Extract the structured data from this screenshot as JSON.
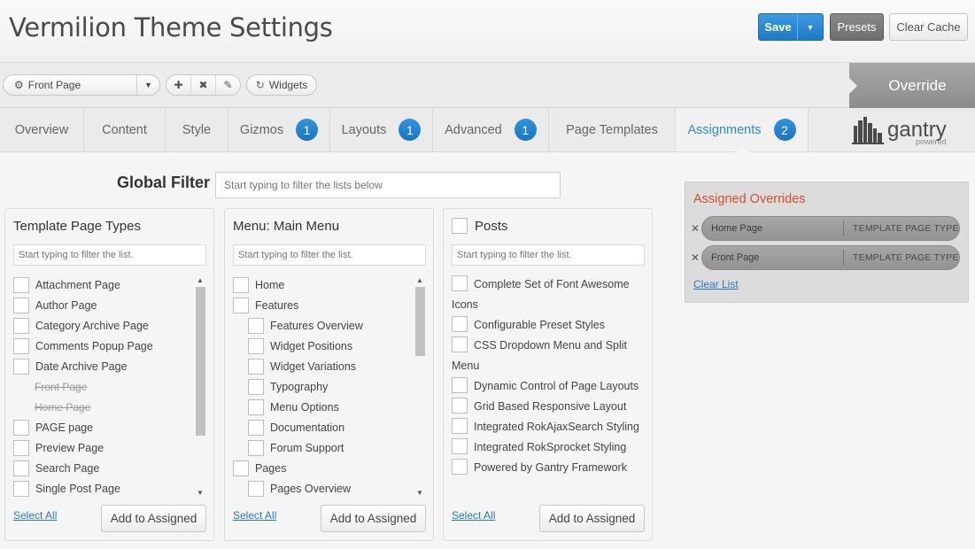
{
  "header": {
    "title": "Vermilion Theme Settings",
    "save_label": "Save",
    "presets_label": "Presets",
    "clear_cache_label": "Clear Cache"
  },
  "toolbar": {
    "page_selected": "Front Page",
    "widgets_label": "Widgets",
    "override_label": "Override"
  },
  "tabs": [
    {
      "label": "Overview",
      "badge": ""
    },
    {
      "label": "Content",
      "badge": ""
    },
    {
      "label": "Style",
      "badge": ""
    },
    {
      "label": "Gizmos",
      "badge": "1"
    },
    {
      "label": "Layouts",
      "badge": "1"
    },
    {
      "label": "Advanced",
      "badge": "1"
    },
    {
      "label": "Page Templates",
      "badge": ""
    },
    {
      "label": "Assignments",
      "badge": "2"
    }
  ],
  "logo": {
    "name": "gantry",
    "sub": "powered"
  },
  "global_filter": {
    "label": "Global Filter",
    "placeholder": "Start typing to filter the lists below"
  },
  "panels": {
    "filter_placeholder": "Start typing to filter the list.",
    "select_all_label": "Select All",
    "add_label": "Add to Assigned",
    "template_page_types": {
      "title": "Template Page Types",
      "items": [
        {
          "label": "Attachment Page",
          "kind": "normal"
        },
        {
          "label": "Author Page",
          "kind": "normal"
        },
        {
          "label": "Category Archive Page",
          "kind": "normal"
        },
        {
          "label": "Comments Popup Page",
          "kind": "normal"
        },
        {
          "label": "Date Archive Page",
          "kind": "normal"
        },
        {
          "label": "Front Page",
          "kind": "strike"
        },
        {
          "label": "Home Page",
          "kind": "strike"
        },
        {
          "label": "PAGE page",
          "kind": "normal"
        },
        {
          "label": "Preview Page",
          "kind": "normal"
        },
        {
          "label": "Search Page",
          "kind": "normal"
        },
        {
          "label": "Single Post Page",
          "kind": "normal"
        }
      ]
    },
    "main_menu": {
      "title": "Menu: Main Menu",
      "items": [
        {
          "label": "Home",
          "kind": "normal"
        },
        {
          "label": "Features",
          "kind": "normal"
        },
        {
          "label": "Features Overview",
          "kind": "sub"
        },
        {
          "label": "Widget Positions",
          "kind": "sub"
        },
        {
          "label": "Widget Variations",
          "kind": "sub"
        },
        {
          "label": "Typography",
          "kind": "sub"
        },
        {
          "label": "Menu Options",
          "kind": "sub"
        },
        {
          "label": "Documentation",
          "kind": "sub"
        },
        {
          "label": "Forum Support",
          "kind": "sub"
        },
        {
          "label": "Pages",
          "kind": "normal"
        },
        {
          "label": "Pages Overview",
          "kind": "sub"
        }
      ]
    },
    "posts": {
      "title": "Posts",
      "items": [
        {
          "label": "Complete Set of Font Awesome Icons"
        },
        {
          "label": "Configurable Preset Styles"
        },
        {
          "label": "CSS Dropdown Menu and Split Menu"
        },
        {
          "label": "Dynamic Control of Page Layouts"
        },
        {
          "label": "Grid Based Responsive Layout"
        },
        {
          "label": "Integrated RokAjaxSearch Styling"
        },
        {
          "label": "Integrated RokSprocket Styling"
        },
        {
          "label": "Powered by Gantry Framework"
        }
      ]
    }
  },
  "assigned": {
    "title": "Assigned Overrides",
    "clear_label": "Clear List",
    "items": [
      {
        "name": "Home Page",
        "type": "TEMPLATE PAGE TYPE"
      },
      {
        "name": "Front Page",
        "type": "TEMPLATE PAGE TYPE"
      }
    ]
  },
  "colors": {
    "accent": "#2a8cd6",
    "assigned_title": "#d3502b",
    "presets_bg": "#7a7a7a"
  }
}
